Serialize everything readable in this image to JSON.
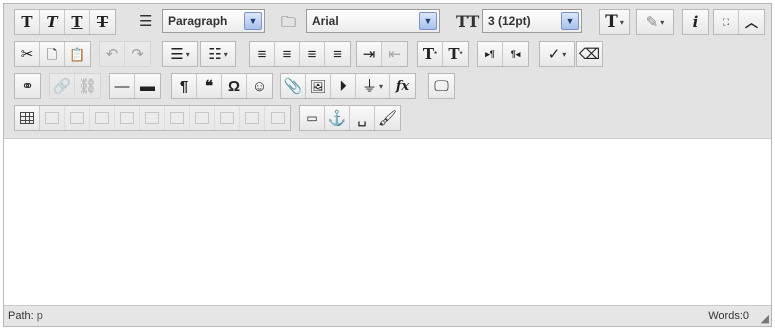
{
  "toolbar": {
    "block_format": "Paragraph",
    "font_family": "Arial",
    "font_size": "3 (12pt)",
    "icons_row1": [
      "bold-icon",
      "italic-icon",
      "underline-icon",
      "strikethrough-icon"
    ],
    "glyphs": {
      "bold": "T",
      "italic": "T",
      "underline": "T",
      "strike": "T",
      "info": "i",
      "text_color": "T",
      "superscript": "T",
      "subscript": "T",
      "super_mark": "*",
      "sub_mark": "*",
      "ltr": "▸¶",
      "rtl": "¶◂",
      "pilcrow": "¶",
      "quote": "❝",
      "omega": "Ω",
      "smiley": "☺",
      "formula": "fx",
      "hr_thin": "—",
      "hr_thick": "▬"
    }
  },
  "status": {
    "path_label": "Path:",
    "path_value": "p",
    "words": "Words:0"
  }
}
